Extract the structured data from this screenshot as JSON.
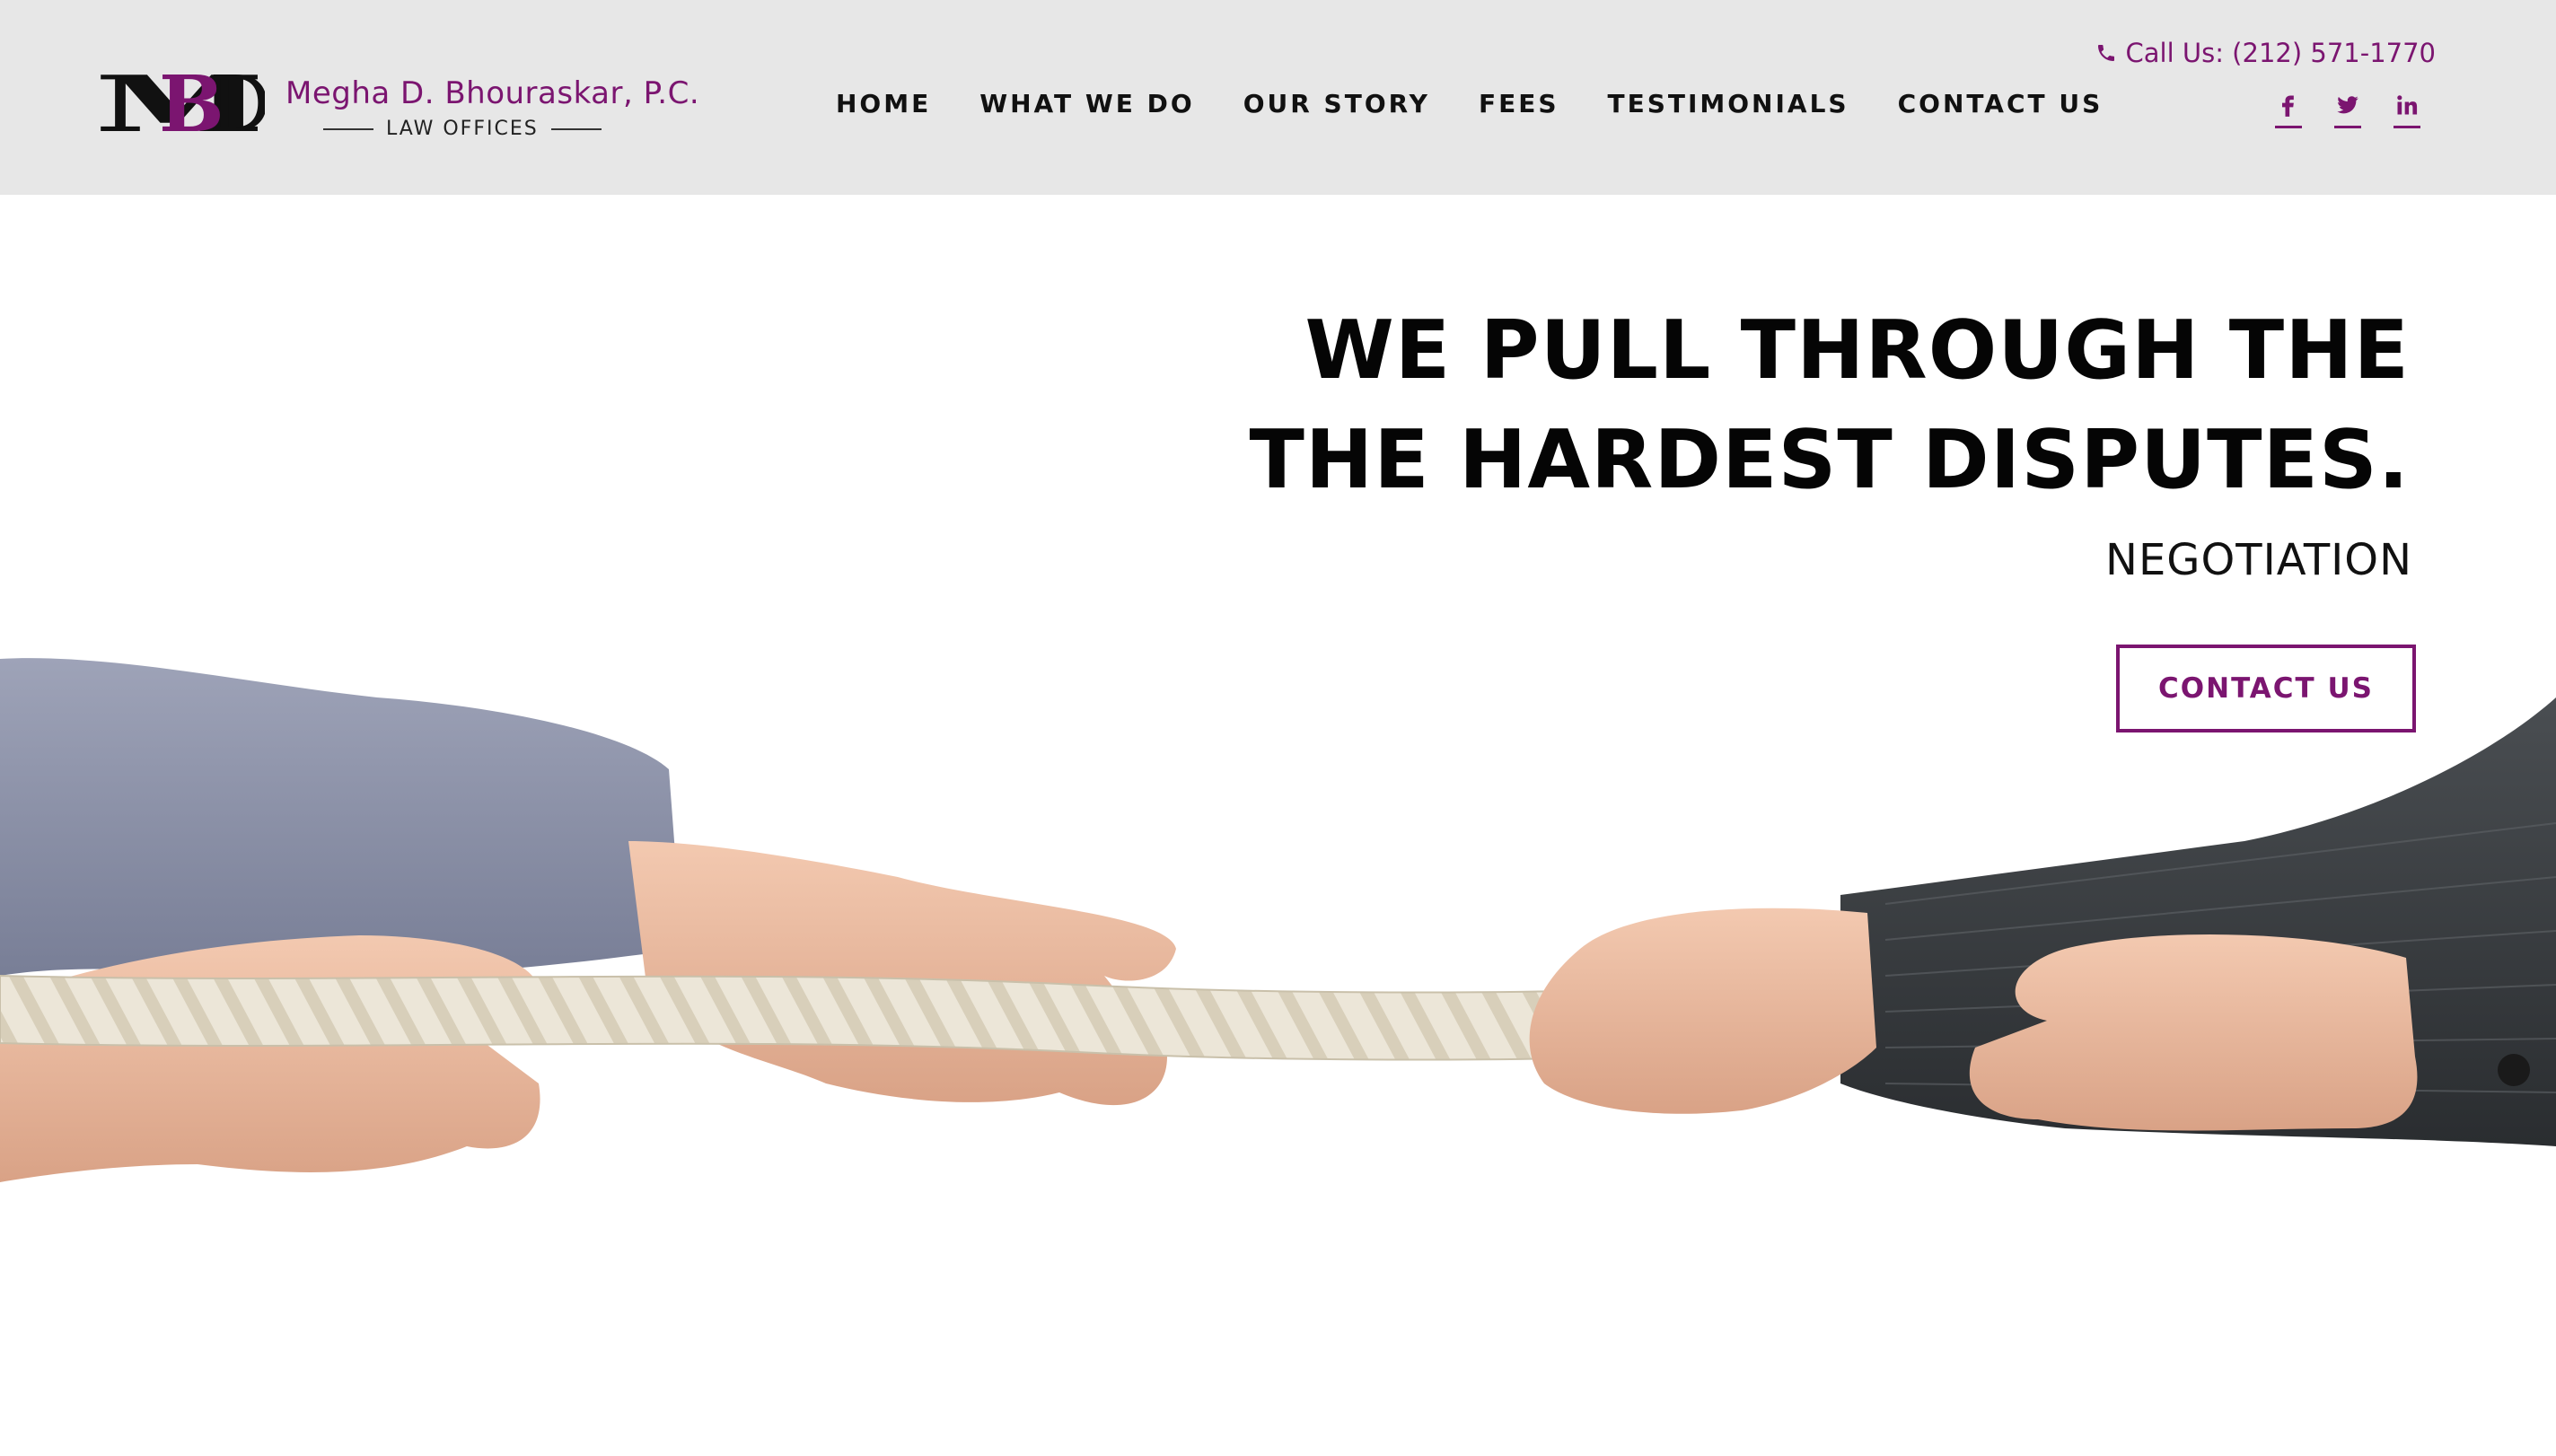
{
  "brand": {
    "logo_letters": "MBD",
    "name": "Megha D. Bhouraskar, P.C.",
    "subtitle": "LAW OFFICES"
  },
  "nav": {
    "items": [
      {
        "label": "HOME"
      },
      {
        "label": "WHAT WE DO"
      },
      {
        "label": "OUR STORY"
      },
      {
        "label": "FEES"
      },
      {
        "label": "TESTIMONIALS"
      },
      {
        "label": "CONTACT US"
      }
    ]
  },
  "contact": {
    "phone_label": "Call Us: (212) 571-1770",
    "icon": "phone-icon"
  },
  "socials": [
    {
      "icon": "facebook-icon"
    },
    {
      "icon": "twitter-icon"
    },
    {
      "icon": "linkedin-icon"
    }
  ],
  "hero": {
    "title_line1": "WE PULL THROUGH THE",
    "title_line2": "THE HARDEST DISPUTES.",
    "subtitle": "NEGOTIATION",
    "cta_label": "CONTACT US"
  },
  "colors": {
    "accent": "#7b1570",
    "header_bg": "#e7e7e7",
    "text": "#050505"
  }
}
